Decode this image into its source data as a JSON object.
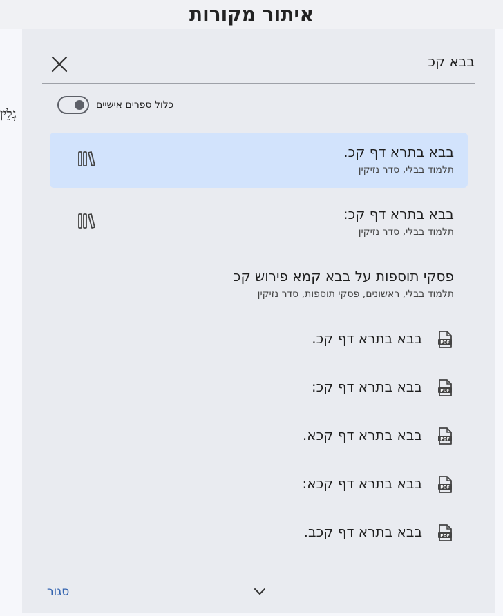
{
  "dialog": {
    "title": "איתור מקורות",
    "search": {
      "value": "בבא קכ"
    },
    "include_personal_label": "כלול ספרים אישיים",
    "close_label": "סגור"
  },
  "background": {
    "fragment_text": "גְלֵין",
    "parens": [
      "(",
      "(",
      "(",
      "(",
      "(",
      "(",
      "(",
      "(",
      "(",
      "(",
      "(",
      "(",
      "(",
      "(",
      "(",
      "("
    ]
  },
  "results": [
    {
      "title": "בבא בתרא דף קכ.",
      "subtitle": "תלמוד בבלי, סדר נזיקין",
      "icon": "library-icon",
      "selected": true
    },
    {
      "title": "בבא בתרא דף קכ:",
      "subtitle": "תלמוד בבלי, סדר נזיקין",
      "icon": "library-icon",
      "selected": false
    },
    {
      "title": "פסקי תוספות על בבא קמא פירוש קכ",
      "subtitle": "תלמוד בבלי, ראשונים, פסקי תוספות, סדר נזיקין",
      "icon": "",
      "selected": false
    }
  ],
  "pdf_results": [
    {
      "title": "בבא בתרא דף קכ.",
      "icon": "pdf-icon"
    },
    {
      "title": "בבא בתרא דף קכ:",
      "icon": "pdf-icon"
    },
    {
      "title": "בבא בתרא דף קכא.",
      "icon": "pdf-icon"
    },
    {
      "title": "בבא בתרא דף קכא:",
      "icon": "pdf-icon"
    },
    {
      "title": "בבא בתרא דף קכב.",
      "icon": "pdf-icon"
    }
  ],
  "colors": {
    "selected_bg": "#d2e3fc",
    "link": "#3565b0",
    "dialog_bg": "#e9ebf0"
  }
}
